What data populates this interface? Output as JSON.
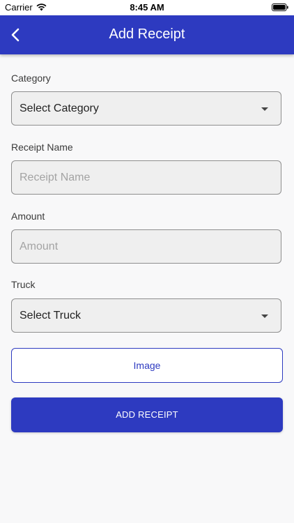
{
  "status_bar": {
    "carrier": "Carrier",
    "time": "8:45 AM"
  },
  "header": {
    "title": "Add Receipt",
    "back_icon": "chevron-left-icon"
  },
  "form": {
    "category": {
      "label": "Category",
      "value": "Select Category"
    },
    "receipt_name": {
      "label": "Receipt Name",
      "placeholder": "Receipt Name"
    },
    "amount": {
      "label": "Amount",
      "placeholder": "Amount"
    },
    "truck": {
      "label": "Truck",
      "value": "Select Truck"
    }
  },
  "buttons": {
    "image_label": "Image",
    "submit_label": "ADD RECEIPT"
  },
  "colors": {
    "primary": "#2d3ac0",
    "field_bg": "#efefef",
    "page_bg": "#f8f8f9"
  }
}
